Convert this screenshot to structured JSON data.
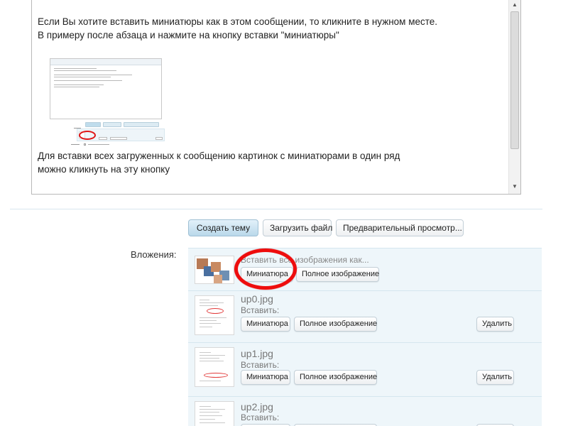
{
  "editor": {
    "paragraph1_line1": "Если Вы хотите вставить миниатюры как в этом сообщении, то кликните в нужном месте.",
    "paragraph1_line2": "В примеру после абзаца и нажмите на кнопку вставки \"миниатюры\"",
    "paragraph2_line1": "Для вставки всех загруженных к сообщению картинок с миниатюрами в один ряд",
    "paragraph2_line2": "можно кликнуть на эту кнопку",
    "scroll_up_icon": "scroll-up-arrow-icon",
    "scroll_down_icon": "scroll-down-arrow-icon"
  },
  "toolbar": {
    "create_topic": "Создать тему",
    "upload_file": "Загрузить файл",
    "preview": "Предварительный просмотр..."
  },
  "attachments": {
    "label": "Вложения:",
    "insert_all": "Вставить все изображения как...",
    "thumbnail_button": "Миниатюра",
    "full_image_button": "Полное изображение",
    "insert_label": "Вставить:",
    "delete_button": "Удалить",
    "items": [
      {
        "filename": "up0.jpg"
      },
      {
        "filename": "up1.jpg"
      },
      {
        "filename": "up2.jpg"
      }
    ]
  },
  "colors": {
    "highlight_circle": "#ee0d0d",
    "attachment_bg": "#eef6fa",
    "primary_button": "#b9d8ea"
  }
}
